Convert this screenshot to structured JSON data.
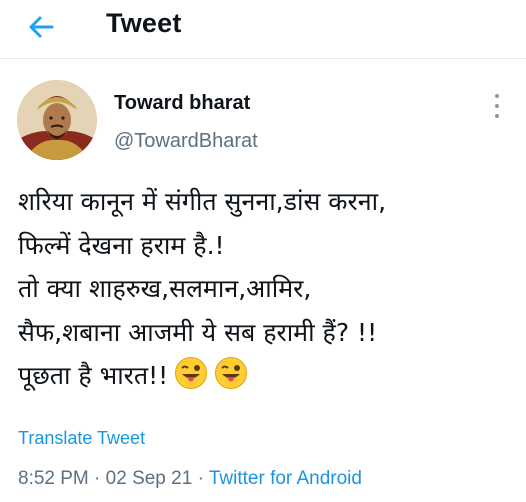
{
  "header": {
    "back_icon": "back-arrow-icon",
    "title": "Tweet",
    "accent": "#1da1f2"
  },
  "author": {
    "name": "Toward bharat",
    "handle": "@TowardBharat",
    "avatar": "avatar-portrait-icon"
  },
  "tweet": {
    "lines": [
      "शरिया कानून में संगीत सुनना,डांस करना,",
      "फिल्में देखना हराम है.!",
      "तो क्या शाहरुख,सलमान,आमिर,",
      "सैफ,शबाना आजमी ये सब हरामी हैं? !!",
      "पूछता है भारत!!"
    ],
    "emojis": [
      "winking-tongue-emoji",
      "winking-tongue-emoji"
    ]
  },
  "translate_label": "Translate Tweet",
  "meta": {
    "time": "8:52 PM",
    "separator": " · ",
    "date": "02 Sep 21",
    "source": "Twitter for Android"
  }
}
